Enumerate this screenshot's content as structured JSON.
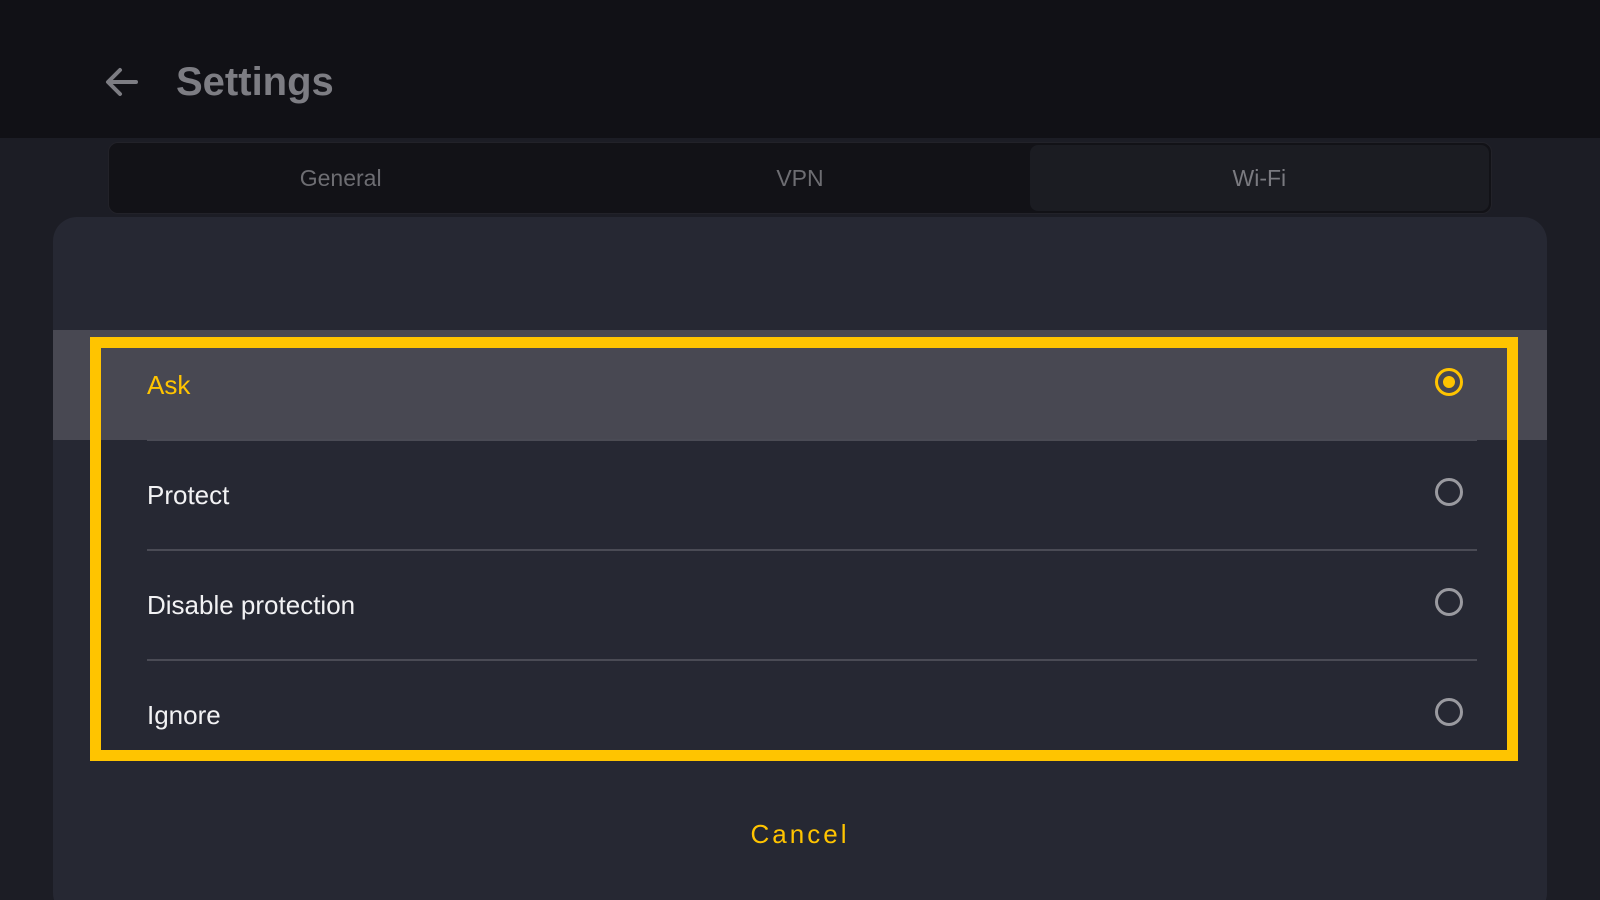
{
  "header": {
    "title": "Settings",
    "back_icon": "arrow-left-icon"
  },
  "tabs": [
    {
      "label": "General"
    },
    {
      "label": "VPN"
    },
    {
      "label": "Wi-Fi",
      "active": true
    }
  ],
  "dialog": {
    "options": [
      {
        "label": "Ask",
        "selected": true
      },
      {
        "label": "Protect",
        "selected": false
      },
      {
        "label": "Disable protection",
        "selected": false
      },
      {
        "label": "Ignore",
        "selected": false
      }
    ],
    "cancel_label": "Cancel"
  },
  "colors": {
    "accent": "#ffc400",
    "dialog_bg": "#262833",
    "selected_row_bg": "#484852",
    "appbar_bg": "#111116"
  }
}
